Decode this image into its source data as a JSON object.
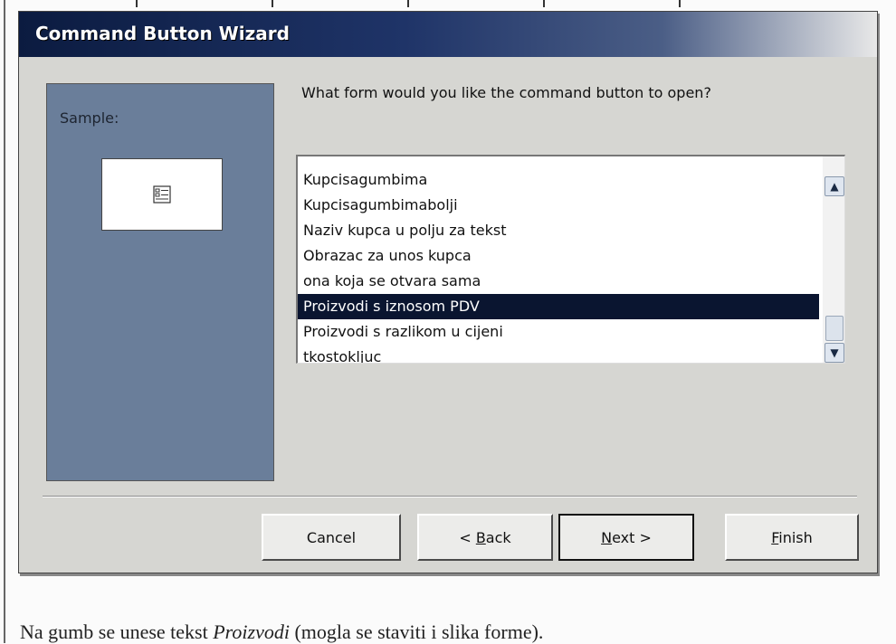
{
  "window": {
    "title": "Command Button Wizard",
    "sample_label": "Sample:",
    "question": "What form would you like the command button to open?"
  },
  "list": {
    "items": [
      "Kupcisagumbima",
      "Kupcisagumbimabolji",
      "Naziv kupca u polju za tekst",
      "Obrazac za unos kupca",
      "ona koja se otvara sama",
      "Proizvodi s iznosom PDV",
      "Proizvodi s razlikom u cijeni",
      "tkostokljuc"
    ],
    "selected_index": 5,
    "scroll_up_icon": "chevron-up-icon",
    "scroll_down_icon": "chevron-down-icon"
  },
  "buttons": {
    "cancel": "Cancel",
    "back_prefix": "< ",
    "back_hotkey": "B",
    "back_rest": "ack",
    "next_hotkey": "N",
    "next_rest": "ext >",
    "finish_hotkey": "F",
    "finish_rest": "inish"
  },
  "caption": {
    "before": "Na gumb se unese tekst ",
    "emph": "Proizvodi",
    "after": " (mogla se staviti i slika forme)."
  },
  "colors": {
    "title_gradient_start": "#0b1b40",
    "selection": "#0a1530",
    "sample_panel": "#6a7e9a"
  }
}
